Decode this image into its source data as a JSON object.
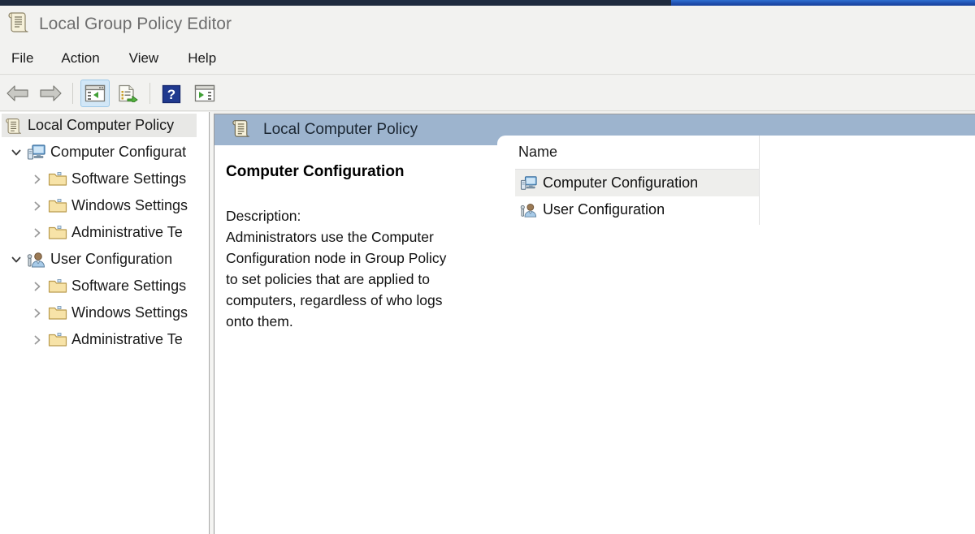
{
  "window": {
    "title": "Local Group Policy Editor",
    "title_icon": "policy-scroll-icon"
  },
  "theme": {
    "title_text_color": "#6e6e6e",
    "pane_header_bg": "#9db4ce",
    "toolbar_active_bg": "#d2e7f7",
    "selection_bg": "#e8e8e6",
    "accent_blue": "#1f4fae",
    "accent_dark": "#1f2b3e"
  },
  "menubar": {
    "items": [
      {
        "label": "File"
      },
      {
        "label": "Action"
      },
      {
        "label": "View"
      },
      {
        "label": "Help"
      }
    ]
  },
  "toolbar": {
    "buttons": [
      {
        "name": "back-button",
        "icon": "arrow-left-icon",
        "label": "Back",
        "active": false
      },
      {
        "name": "forward-button",
        "icon": "arrow-right-icon",
        "label": "Forward",
        "active": false
      },
      {
        "name": "show-hide-console-tree-button",
        "icon": "console-tree-icon",
        "label": "Show/Hide Console Tree",
        "active": true
      },
      {
        "name": "export-list-button",
        "icon": "export-list-icon",
        "label": "Export List",
        "active": false
      },
      {
        "name": "help-button",
        "icon": "help-question-icon",
        "label": "Help",
        "active": false
      },
      {
        "name": "show-hide-action-pane-button",
        "icon": "action-pane-icon",
        "label": "Show/Hide Action Pane",
        "active": false
      }
    ]
  },
  "tree": {
    "nodes": [
      {
        "label": "Local Computer Policy",
        "icon": "policy-scroll-icon",
        "indent": 0,
        "expander": "none",
        "selected": true
      },
      {
        "label": "Computer Configurat",
        "icon": "computer-config-icon",
        "indent": 1,
        "expander": "expanded",
        "selected": false
      },
      {
        "label": "Software Settings",
        "icon": "folder-icon",
        "indent": 2,
        "expander": "collapsed",
        "selected": false
      },
      {
        "label": "Windows Settings",
        "icon": "folder-icon",
        "indent": 2,
        "expander": "collapsed",
        "selected": false
      },
      {
        "label": "Administrative Te",
        "icon": "folder-icon",
        "indent": 2,
        "expander": "collapsed",
        "selected": false
      },
      {
        "label": "User Configuration",
        "icon": "user-config-icon",
        "indent": 1,
        "expander": "expanded",
        "selected": false
      },
      {
        "label": "Software Settings",
        "icon": "folder-icon",
        "indent": 2,
        "expander": "collapsed",
        "selected": false
      },
      {
        "label": "Windows Settings",
        "icon": "folder-icon",
        "indent": 2,
        "expander": "collapsed",
        "selected": false
      },
      {
        "label": "Administrative Te",
        "icon": "folder-icon",
        "indent": 2,
        "expander": "collapsed",
        "selected": false
      }
    ]
  },
  "pane": {
    "header_title": "Local Computer Policy",
    "header_icon": "policy-scroll-icon",
    "detail": {
      "title": "Computer Configuration",
      "description_label": "Description:",
      "description_lines": [
        "Administrators use the Computer",
        "Configuration node in Group Policy",
        "to set policies that are applied to",
        "computers, regardless of who logs",
        "onto them."
      ]
    },
    "list": {
      "columns": [
        {
          "label": "Name"
        }
      ],
      "rows": [
        {
          "label": "Computer Configuration",
          "icon": "computer-config-icon",
          "selected": true
        },
        {
          "label": "User Configuration",
          "icon": "user-config-icon",
          "selected": false
        }
      ]
    }
  }
}
